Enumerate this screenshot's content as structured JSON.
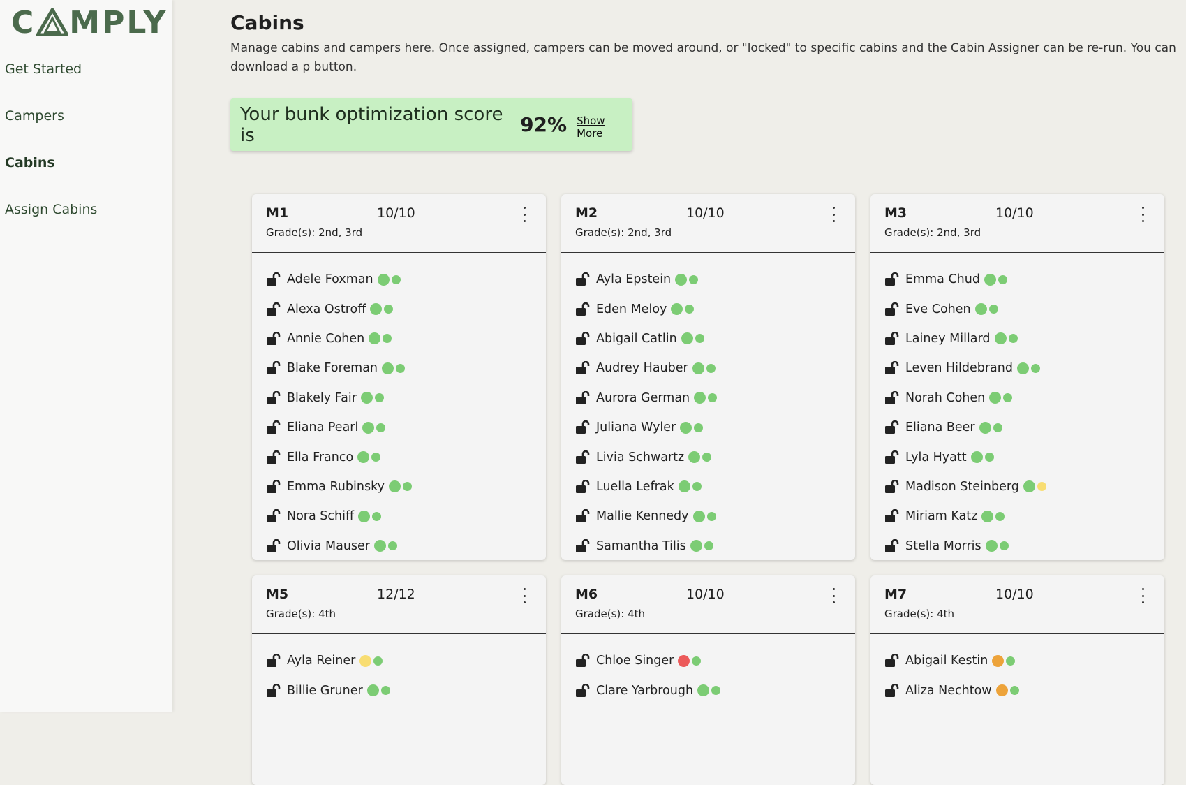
{
  "app": {
    "logo_text": "CAMPLY"
  },
  "sidebar": {
    "items": [
      {
        "label": "Get Started"
      },
      {
        "label": "Campers"
      },
      {
        "label": "Cabins"
      },
      {
        "label": "Assign Cabins"
      }
    ]
  },
  "page": {
    "title": "Cabins",
    "description": "Manage cabins and campers here. Once assigned, campers can be moved around, or \"locked\" to specific cabins and the Cabin Assigner can be re-run. You can download a p button."
  },
  "score": {
    "prefix": "Your bunk optimization score is",
    "value": "92%",
    "show_more": "Show More"
  },
  "colors": {
    "green": "#7ccc74",
    "yellow": "#f8dd72",
    "red": "#ec5a5a",
    "orange": "#eda33a",
    "score_bg": "#c8f0c3",
    "logo": "#4b6a4c"
  },
  "icons": {
    "lock": "unlocked-padlock-icon",
    "menu": "kebab-menu-icon"
  },
  "cabins": [
    {
      "name": "M1",
      "count": "10/10",
      "grades": "Grade(s): 2nd, 3rd",
      "campers": [
        {
          "name": "Adele Foxman",
          "dots": [
            "green",
            "green"
          ]
        },
        {
          "name": "Alexa Ostroff",
          "dots": [
            "green",
            "green"
          ]
        },
        {
          "name": "Annie Cohen",
          "dots": [
            "green",
            "green"
          ]
        },
        {
          "name": "Blake Foreman",
          "dots": [
            "green",
            "green"
          ]
        },
        {
          "name": "Blakely Fair",
          "dots": [
            "green",
            "green"
          ]
        },
        {
          "name": "Eliana Pearl",
          "dots": [
            "green",
            "green"
          ]
        },
        {
          "name": "Ella Franco",
          "dots": [
            "green",
            "green"
          ]
        },
        {
          "name": "Emma Rubinsky",
          "dots": [
            "green",
            "green"
          ]
        },
        {
          "name": "Nora Schiff",
          "dots": [
            "green",
            "green"
          ]
        },
        {
          "name": "Olivia Mauser",
          "dots": [
            "green",
            "green"
          ]
        }
      ]
    },
    {
      "name": "M2",
      "count": "10/10",
      "grades": "Grade(s): 2nd, 3rd",
      "campers": [
        {
          "name": "Ayla Epstein",
          "dots": [
            "green",
            "green"
          ]
        },
        {
          "name": "Eden Meloy",
          "dots": [
            "green",
            "green"
          ]
        },
        {
          "name": "Abigail Catlin",
          "dots": [
            "green",
            "green"
          ]
        },
        {
          "name": "Audrey Hauber",
          "dots": [
            "green",
            "green"
          ]
        },
        {
          "name": "Aurora German",
          "dots": [
            "green",
            "green"
          ]
        },
        {
          "name": "Juliana Wyler",
          "dots": [
            "green",
            "green"
          ]
        },
        {
          "name": "Livia Schwartz",
          "dots": [
            "green",
            "green"
          ]
        },
        {
          "name": "Luella Lefrak",
          "dots": [
            "green",
            "green"
          ]
        },
        {
          "name": "Mallie Kennedy",
          "dots": [
            "green",
            "green"
          ]
        },
        {
          "name": "Samantha Tilis",
          "dots": [
            "green",
            "green"
          ]
        }
      ]
    },
    {
      "name": "M3",
      "count": "10/10",
      "grades": "Grade(s): 2nd, 3rd",
      "campers": [
        {
          "name": "Emma Chud",
          "dots": [
            "green",
            "green"
          ]
        },
        {
          "name": "Eve Cohen",
          "dots": [
            "green",
            "green"
          ]
        },
        {
          "name": "Lainey Millard",
          "dots": [
            "green",
            "green"
          ]
        },
        {
          "name": "Leven Hildebrand",
          "dots": [
            "green",
            "green"
          ]
        },
        {
          "name": "Norah Cohen",
          "dots": [
            "green",
            "green"
          ]
        },
        {
          "name": "Eliana Beer",
          "dots": [
            "green",
            "green"
          ]
        },
        {
          "name": "Lyla Hyatt",
          "dots": [
            "green",
            "green"
          ]
        },
        {
          "name": "Madison Steinberg",
          "dots": [
            "green",
            "yellow"
          ]
        },
        {
          "name": "Miriam Katz",
          "dots": [
            "green",
            "green"
          ]
        },
        {
          "name": "Stella Morris",
          "dots": [
            "green",
            "green"
          ]
        }
      ]
    },
    {
      "name": "M5",
      "count": "12/12",
      "grades": "Grade(s): 4th",
      "campers": [
        {
          "name": "Ayla Reiner",
          "dots": [
            "yellow",
            "green"
          ]
        },
        {
          "name": "Billie Gruner",
          "dots": [
            "green",
            "green"
          ]
        }
      ]
    },
    {
      "name": "M6",
      "count": "10/10",
      "grades": "Grade(s): 4th",
      "campers": [
        {
          "name": "Chloe Singer",
          "dots": [
            "red",
            "green"
          ]
        },
        {
          "name": "Clare Yarbrough",
          "dots": [
            "green",
            "green"
          ]
        }
      ]
    },
    {
      "name": "M7",
      "count": "10/10",
      "grades": "Grade(s): 4th",
      "campers": [
        {
          "name": "Abigail Kestin",
          "dots": [
            "orange",
            "green"
          ]
        },
        {
          "name": "Aliza Nechtow",
          "dots": [
            "orange",
            "green"
          ]
        }
      ]
    }
  ]
}
